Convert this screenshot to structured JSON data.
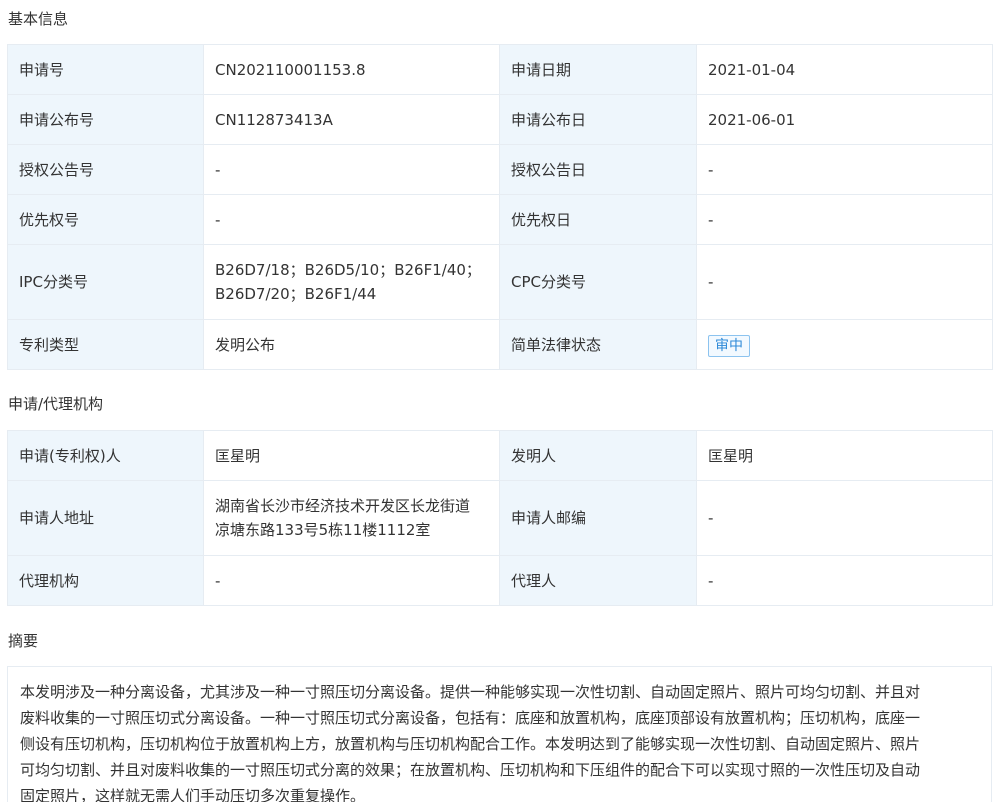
{
  "sections": {
    "basic": "基本信息",
    "agency": "申请/代理机构",
    "abstract": "摘要"
  },
  "basic": {
    "app_no_label": "申请号",
    "app_no": "CN202110001153.8",
    "app_date_label": "申请日期",
    "app_date": "2021-01-04",
    "pub_no_label": "申请公布号",
    "pub_no": "CN112873413A",
    "pub_date_label": "申请公布日",
    "pub_date": "2021-06-01",
    "grant_no_label": "授权公告号",
    "grant_no": "-",
    "grant_date_label": "授权公告日",
    "grant_date": "-",
    "priority_no_label": "优先权号",
    "priority_no": "-",
    "priority_date_label": "优先权日",
    "priority_date": "-",
    "ipc_label": "IPC分类号",
    "ipc_line1": "B26D7/18；B26D5/10；B26F1/40；",
    "ipc_line2": "B26D7/20；B26F1/44",
    "cpc_label": "CPC分类号",
    "cpc": "-",
    "type_label": "专利类型",
    "type": "发明公布",
    "legal_status_label": "简单法律状态",
    "legal_status": "审中"
  },
  "agency": {
    "applicant_label": "申请(专利权)人",
    "applicant": "匡星明",
    "inventor_label": "发明人",
    "inventor": "匡星明",
    "address_label": "申请人地址",
    "address_line1": "湖南省长沙市经济技术开发区长龙街道",
    "address_line2": "凉塘东路133号5栋11楼1112室",
    "postcode_label": "申请人邮编",
    "postcode": "-",
    "agency_label": "代理机构",
    "agency": "-",
    "agent_label": "代理人",
    "agent": "-"
  },
  "abstract": {
    "line1": "本发明涉及一种分离设备，尤其涉及一种一寸照压切分离设备。提供一种能够实现一次性切割、自动固定照片、照片可均匀切割、并且对",
    "line2": "废料收集的一寸照压切式分离设备。一种一寸照压切式分离设备，包括有：底座和放置机构，底座顶部设有放置机构；压切机构，底座一",
    "line3": "侧设有压切机构，压切机构位于放置机构上方，放置机构与压切机构配合工作。本发明达到了能够实现一次性切割、自动固定照片、照片",
    "line4": "可均匀切割、并且对废料收集的一寸照压切式分离的效果；在放置机构、压切机构和下压组件的配合下可以实现寸照的一次性压切及自动",
    "line5": "固定照片，这样就无需人们手动压切多次重复操作。"
  }
}
